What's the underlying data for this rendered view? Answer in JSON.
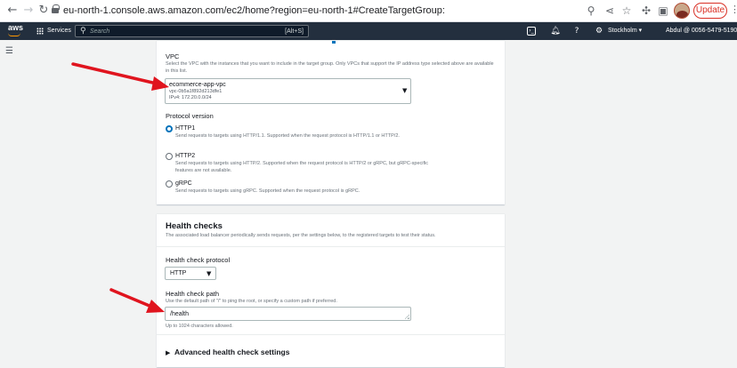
{
  "browser": {
    "back_icon": "arrow-left",
    "forward_icon": "arrow-right",
    "reload_icon": "reload",
    "url": "eu-north-1.console.aws.amazon.com/ec2/home?region=eu-north-1#CreateTargetGroup:",
    "update_label": "Update",
    "icons": [
      "zoom-icon",
      "share-icon",
      "star-icon",
      "puzzle-icon",
      "sidebar-icon",
      "avatar",
      "kebab-icon"
    ]
  },
  "aws_bar": {
    "logo": "aws",
    "services_label": "Services",
    "search_placeholder": "Search",
    "search_shortcut": "[Alt+S]",
    "region": "Stockholm ▾",
    "account": "Abdul @ 0056-5479-5190 ▾",
    "accent_color": "#ff9900",
    "bar_color": "#232f3e"
  },
  "vpc": {
    "label": "VPC",
    "description": "Select the VPC with the instances that you want to include in the target group. Only VPCs that support the IP address type selected above are available in this list.",
    "selected_name": "ecommerce-app-vpc",
    "selected_id": "vpc-0b5a1f892d213dfe1",
    "selected_cidr": "IPv4: 172.20.0.0/24"
  },
  "protocol_version": {
    "label": "Protocol version",
    "options": [
      {
        "title": "HTTP1",
        "description": "Send requests to targets using HTTP/1.1. Supported when the request protocol is HTTP/1.1 or HTTP/2.",
        "checked": true
      },
      {
        "title": "HTTP2",
        "description": "Send requests to targets using HTTP/2. Supported when the request protocol is HTTP/2 or gRPC, but gRPC-specific features are not available.",
        "checked": false
      },
      {
        "title": "gRPC",
        "description": "Send requests to targets using gRPC. Supported when the request protocol is gRPC.",
        "checked": false
      }
    ]
  },
  "health_checks": {
    "heading": "Health checks",
    "description": "The associated load balancer periodically sends requests, per the settings below, to the registered targets to test their status.",
    "protocol_label": "Health check protocol",
    "protocol_value": "HTTP",
    "path_label": "Health check path",
    "path_description": "Use the default path of \"/\" to ping the root, or specify a custom path if preferred.",
    "path_value": "/health",
    "path_constraint": "Up to 1024 characters allowed.",
    "advanced_label": "Advanced health check settings"
  },
  "annotation_color": "#e0141e"
}
